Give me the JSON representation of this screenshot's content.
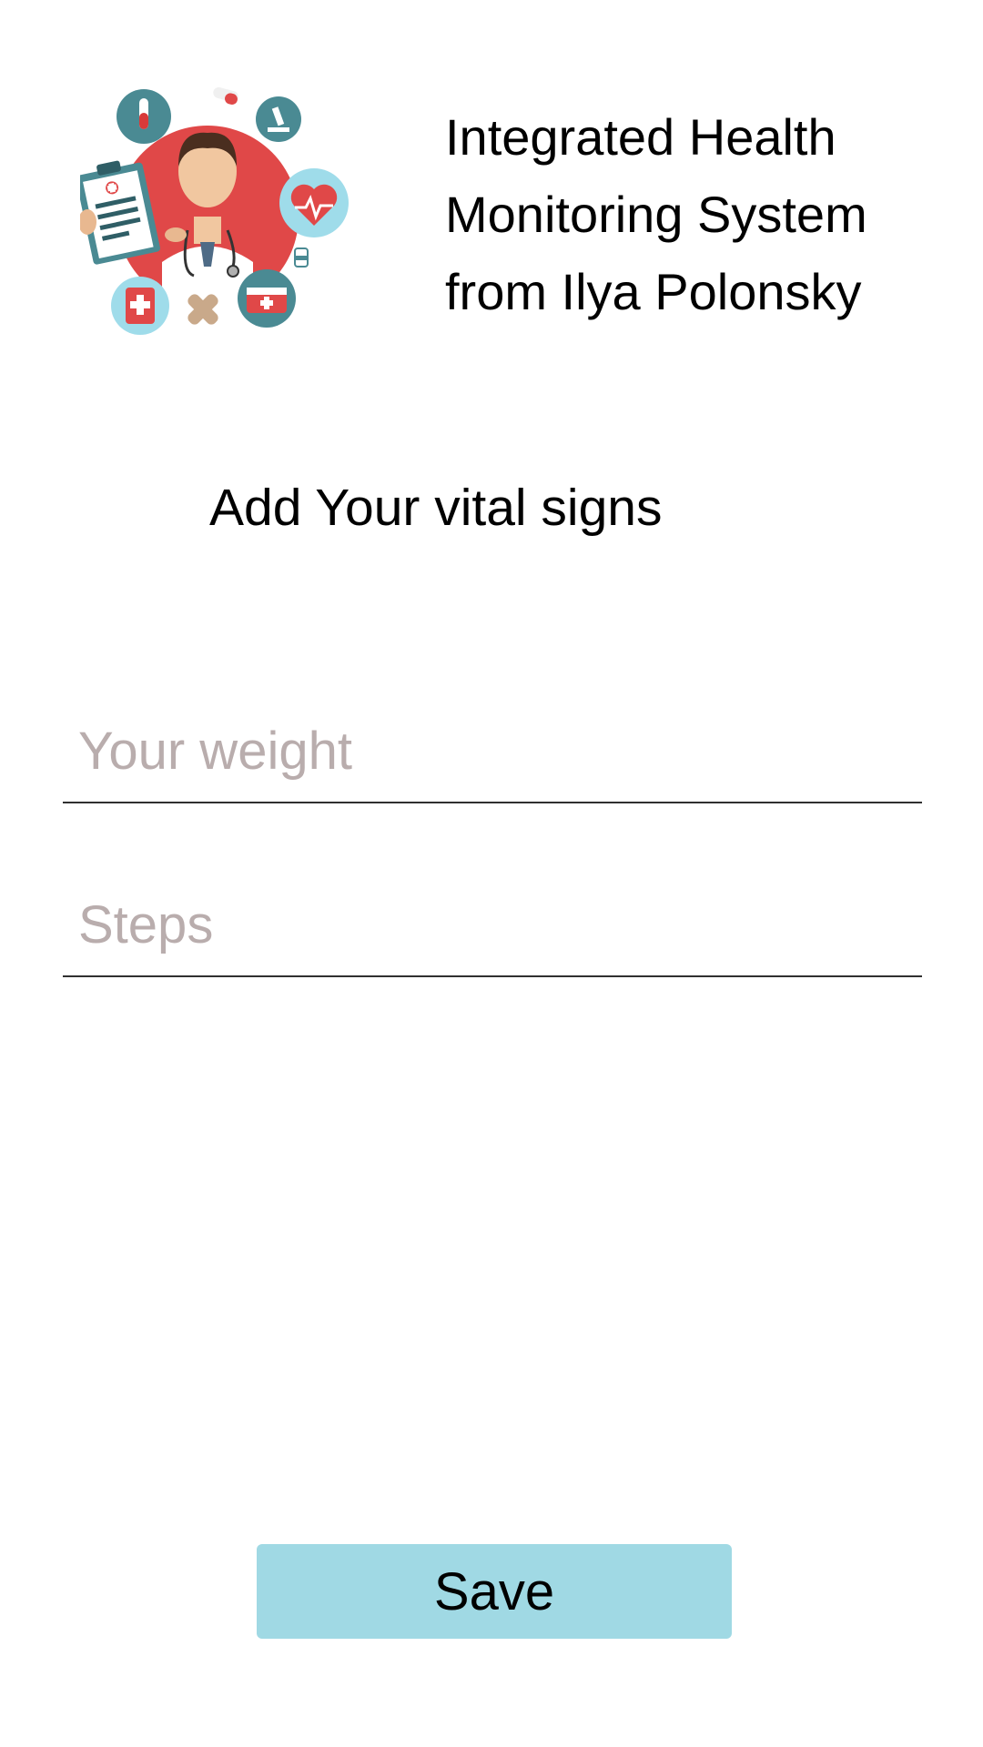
{
  "app": {
    "title": "Integrated Health\nMonitoring System\nfrom Ilya Polonsky",
    "logo_icon": "doctor-with-medical-icons-illustration"
  },
  "form": {
    "heading": "Add Your vital signs",
    "weight": {
      "value": "",
      "placeholder": "Your weight"
    },
    "steps": {
      "value": "",
      "placeholder": "Steps"
    },
    "save_label": "Save"
  },
  "colors": {
    "accent": "#a0d9e4",
    "placeholder": "#b9adad",
    "logo_red": "#e04848",
    "logo_teal": "#4a8a93",
    "logo_light_blue": "#9fdcea"
  }
}
